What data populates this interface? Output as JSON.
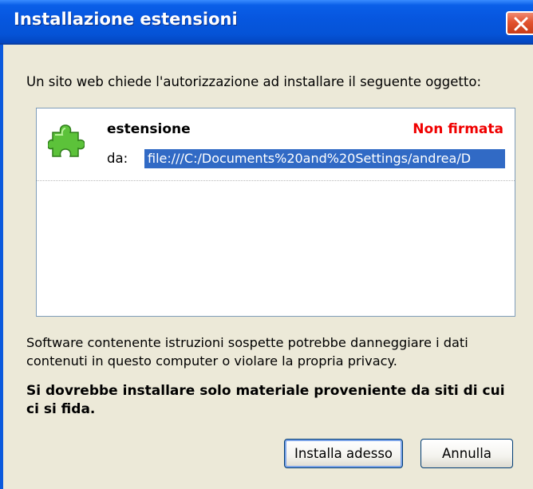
{
  "window": {
    "title": "Installazione estensioni"
  },
  "dialog": {
    "prompt": "Un sito web chiede l'autorizzazione ad installare il seguente oggetto:",
    "item": {
      "icon": "puzzle-piece-icon",
      "name": "estensione",
      "signature_status": "Non firmata",
      "from_label": "da:",
      "url": "file:///C:/Documents%20and%20Settings/andrea/D"
    },
    "warning": "Software contenente istruzioni sospette potrebbe danneggiare i dati contenuti in questo computer o violare la propria privacy.",
    "advice": "Si dovrebbe installare solo materiale proveniente da siti di cui ci si fida."
  },
  "buttons": {
    "install": "Installa adesso",
    "cancel": "Annulla"
  },
  "colors": {
    "titlebar": "#0553d6",
    "dialog_bg": "#ece9d8",
    "unsigned": "#f00000",
    "selection": "#316ac5",
    "close_button": "#e2532f"
  }
}
